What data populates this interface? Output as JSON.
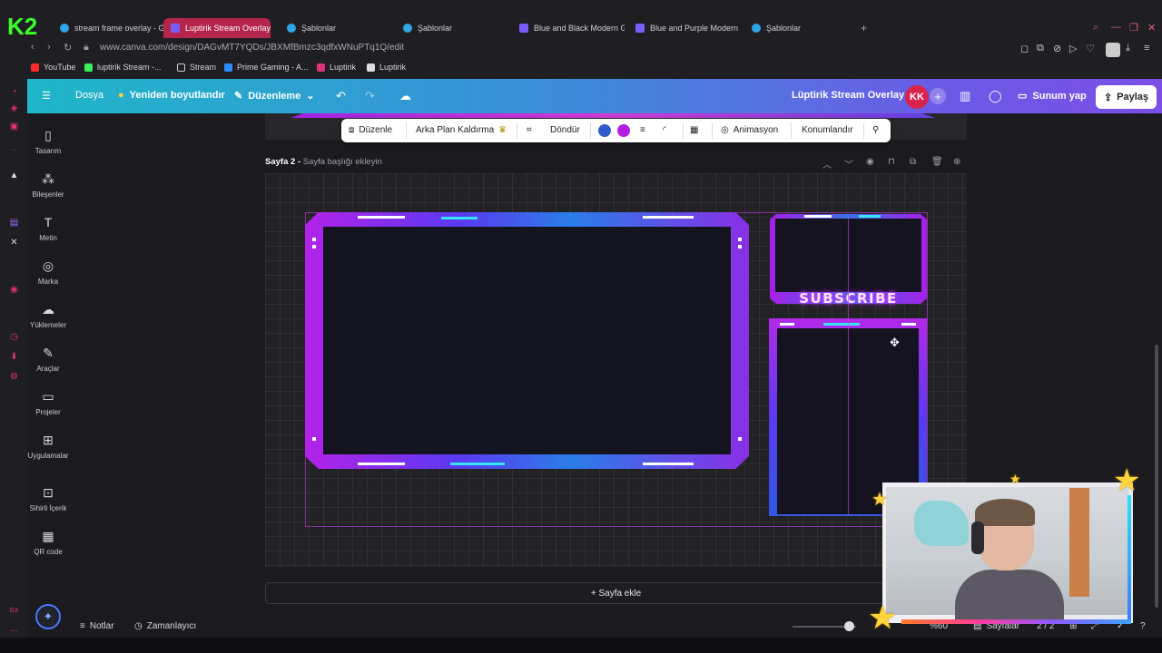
{
  "browser": {
    "tabs": [
      {
        "title": "stream frame overlay - G",
        "icon": "google-icon"
      },
      {
        "title": "Luptirik Stream Overlay -",
        "icon": "twitch-icon",
        "active": true
      },
      {
        "title": "Şablonlar",
        "icon": "canva-icon"
      },
      {
        "title": "Şablonlar",
        "icon": "canva-icon"
      },
      {
        "title": "Blue and Black Modern G",
        "icon": "twitch-icon"
      },
      {
        "title": "Blue and Purple Modern",
        "icon": "twitch-icon"
      },
      {
        "title": "Şablonlar",
        "icon": "canva-icon"
      }
    ],
    "url": "www.canva.com/design/DAGvMT7YQDs/JBXMfBmzc3qdfxWNuPTq1Q/edit",
    "bookmarks": [
      "YouTube",
      "luptirik Stream -...",
      "Stream",
      "Prime Gaming - A...",
      "Luptirik",
      "Luptirik"
    ]
  },
  "header": {
    "file": "Dosya",
    "resize": "Yeniden boyutlandır",
    "edit": "Düzenleme",
    "title": "Lüptirik Stream Overlay",
    "avatar": "KK",
    "present": "Sunum yap",
    "share": "Paylaş"
  },
  "sidebar": {
    "items": [
      {
        "label": "Tasarım",
        "icon": "layout-icon"
      },
      {
        "label": "Bileşenler",
        "icon": "elements-icon"
      },
      {
        "label": "Metin",
        "icon": "text-icon"
      },
      {
        "label": "Marka",
        "icon": "brand-icon"
      },
      {
        "label": "Yüklemeler",
        "icon": "upload-icon"
      },
      {
        "label": "Araçlar",
        "icon": "draw-icon"
      },
      {
        "label": "Projeler",
        "icon": "folder-icon"
      },
      {
        "label": "Uygulamalar",
        "icon": "apps-icon"
      },
      {
        "label": "Sihirli İçerik",
        "icon": "magic-media-icon"
      },
      {
        "label": "QR code",
        "icon": "qr-icon"
      }
    ]
  },
  "toolbar": {
    "edit": "Düzenle",
    "bg_remove": "Arka Plan Kaldırma",
    "rotate": "Döndür",
    "animate": "Animasyon",
    "position": "Konumlandır",
    "colors": [
      "#2f5cc8",
      "#b31ee0"
    ]
  },
  "page": {
    "label": "Sayfa 2 -",
    "title_placeholder": "Sayfa başlığı ekleyin",
    "subscribe_text": "SUBSCRIBE",
    "add_page": "+ Sayfa ekle"
  },
  "footer": {
    "notes": "Notlar",
    "timer": "Zamanlayıcı",
    "zoom": "%60",
    "pages": "Sayfalar",
    "page_count": "2 / 2"
  }
}
